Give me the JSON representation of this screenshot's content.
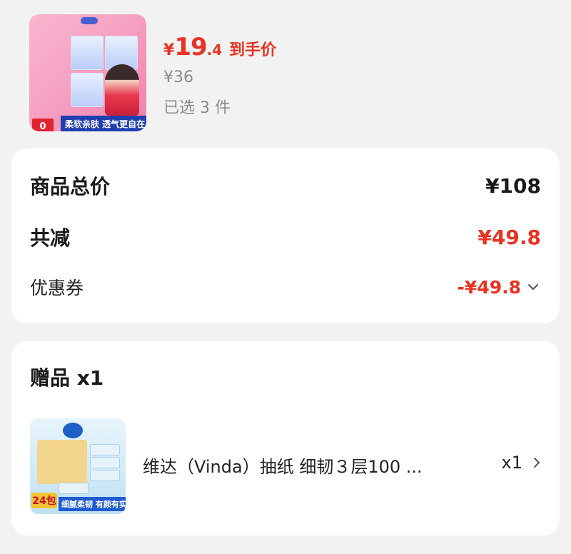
{
  "product": {
    "thumbnail_icon": "sanitary-pad-product-image",
    "thumb_badge": "0",
    "thumb_strip": "柔软亲肤 透气更自在",
    "price": {
      "symbol": "¥",
      "integer": "19",
      "decimal": ".4",
      "tag": "到手价"
    },
    "original_price": "¥36",
    "selected": "已选 3 件"
  },
  "summary": {
    "total_label": "商品总价",
    "total_value": "¥108",
    "discount_label": "共减",
    "discount_value": "¥49.8",
    "coupon_label": "优惠券",
    "coupon_value": "-¥49.8",
    "coupon_icon": "chevron-down-icon"
  },
  "gift": {
    "title": "赠品 x1",
    "thumbnail_icon": "tissue-product-image",
    "thumb_badge": "24包",
    "thumb_strip": "细腻柔韧 有颜有实力",
    "name": "维达（Vinda）抽纸 细韧３层100 ...",
    "qty": "x1",
    "qty_icon": "chevron-right-icon"
  },
  "colors": {
    "accent_red": "#e93323",
    "page_bg": "#f2f2f2",
    "muted_text": "#8a8a8a"
  }
}
